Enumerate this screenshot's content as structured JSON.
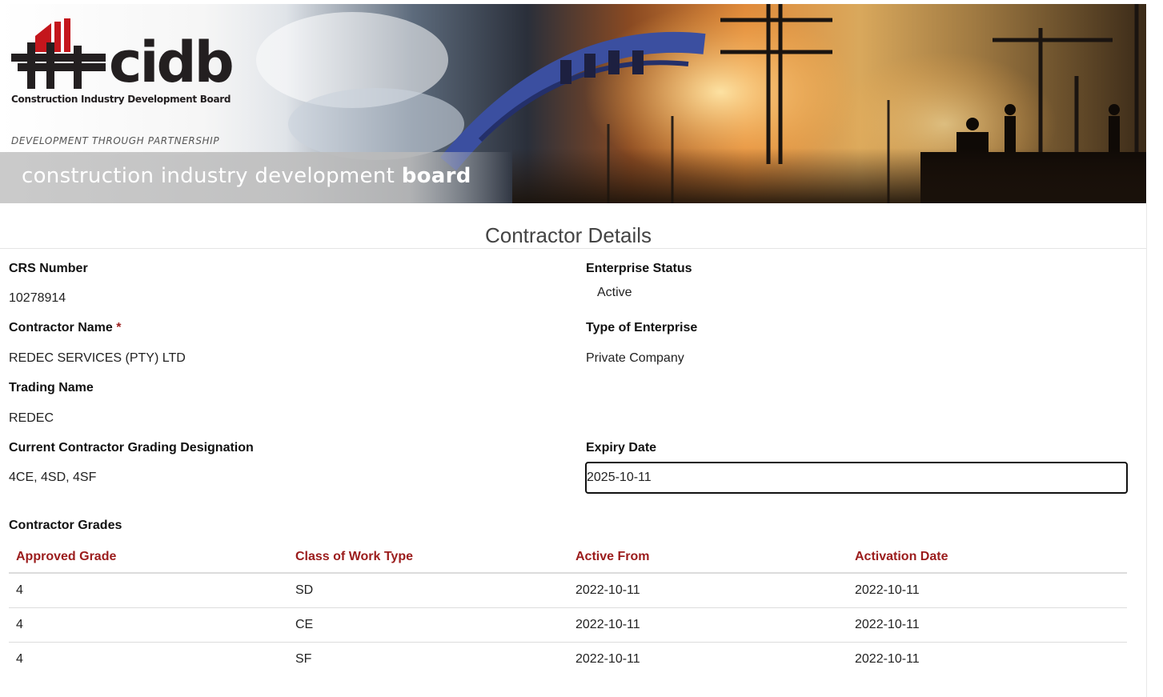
{
  "banner": {
    "logo_text": "cidb",
    "logo_subtitle": "Construction Industry Development Board",
    "logo_tagline": "DEVELOPMENT THROUGH PARTNERSHIP",
    "strip_text_regular": "construction industry development ",
    "strip_text_bold": "board"
  },
  "page": {
    "title": "Contractor Details"
  },
  "details": {
    "crs_number_label": "CRS Number",
    "crs_number_value": "10278914",
    "enterprise_status_label": "Enterprise Status",
    "enterprise_status_value": "Active",
    "contractor_name_label": "Contractor Name",
    "contractor_name_required": "*",
    "contractor_name_value": "REDEC SERVICES (PTY) LTD",
    "type_of_enterprise_label": "Type of Enterprise",
    "type_of_enterprise_value": "Private Company",
    "trading_name_label": "Trading Name",
    "trading_name_value": "REDEC",
    "grading_designation_label": "Current Contractor Grading Designation",
    "grading_designation_value": "4CE, 4SD, 4SF",
    "expiry_date_label": "Expiry Date",
    "expiry_date_value": "2025-10-11"
  },
  "grades": {
    "title": "Contractor Grades",
    "columns": [
      "Approved Grade",
      "Class of Work Type",
      "Active From",
      "Activation Date"
    ],
    "rows": [
      [
        "4",
        "SD",
        "2022-10-11",
        "2022-10-11"
      ],
      [
        "4",
        "CE",
        "2022-10-11",
        "2022-10-11"
      ],
      [
        "4",
        "SF",
        "2022-10-11",
        "2022-10-11"
      ]
    ]
  },
  "colors": {
    "accent": "#9b1c1c",
    "logo_red": "#c4161c",
    "text": "#212529"
  }
}
